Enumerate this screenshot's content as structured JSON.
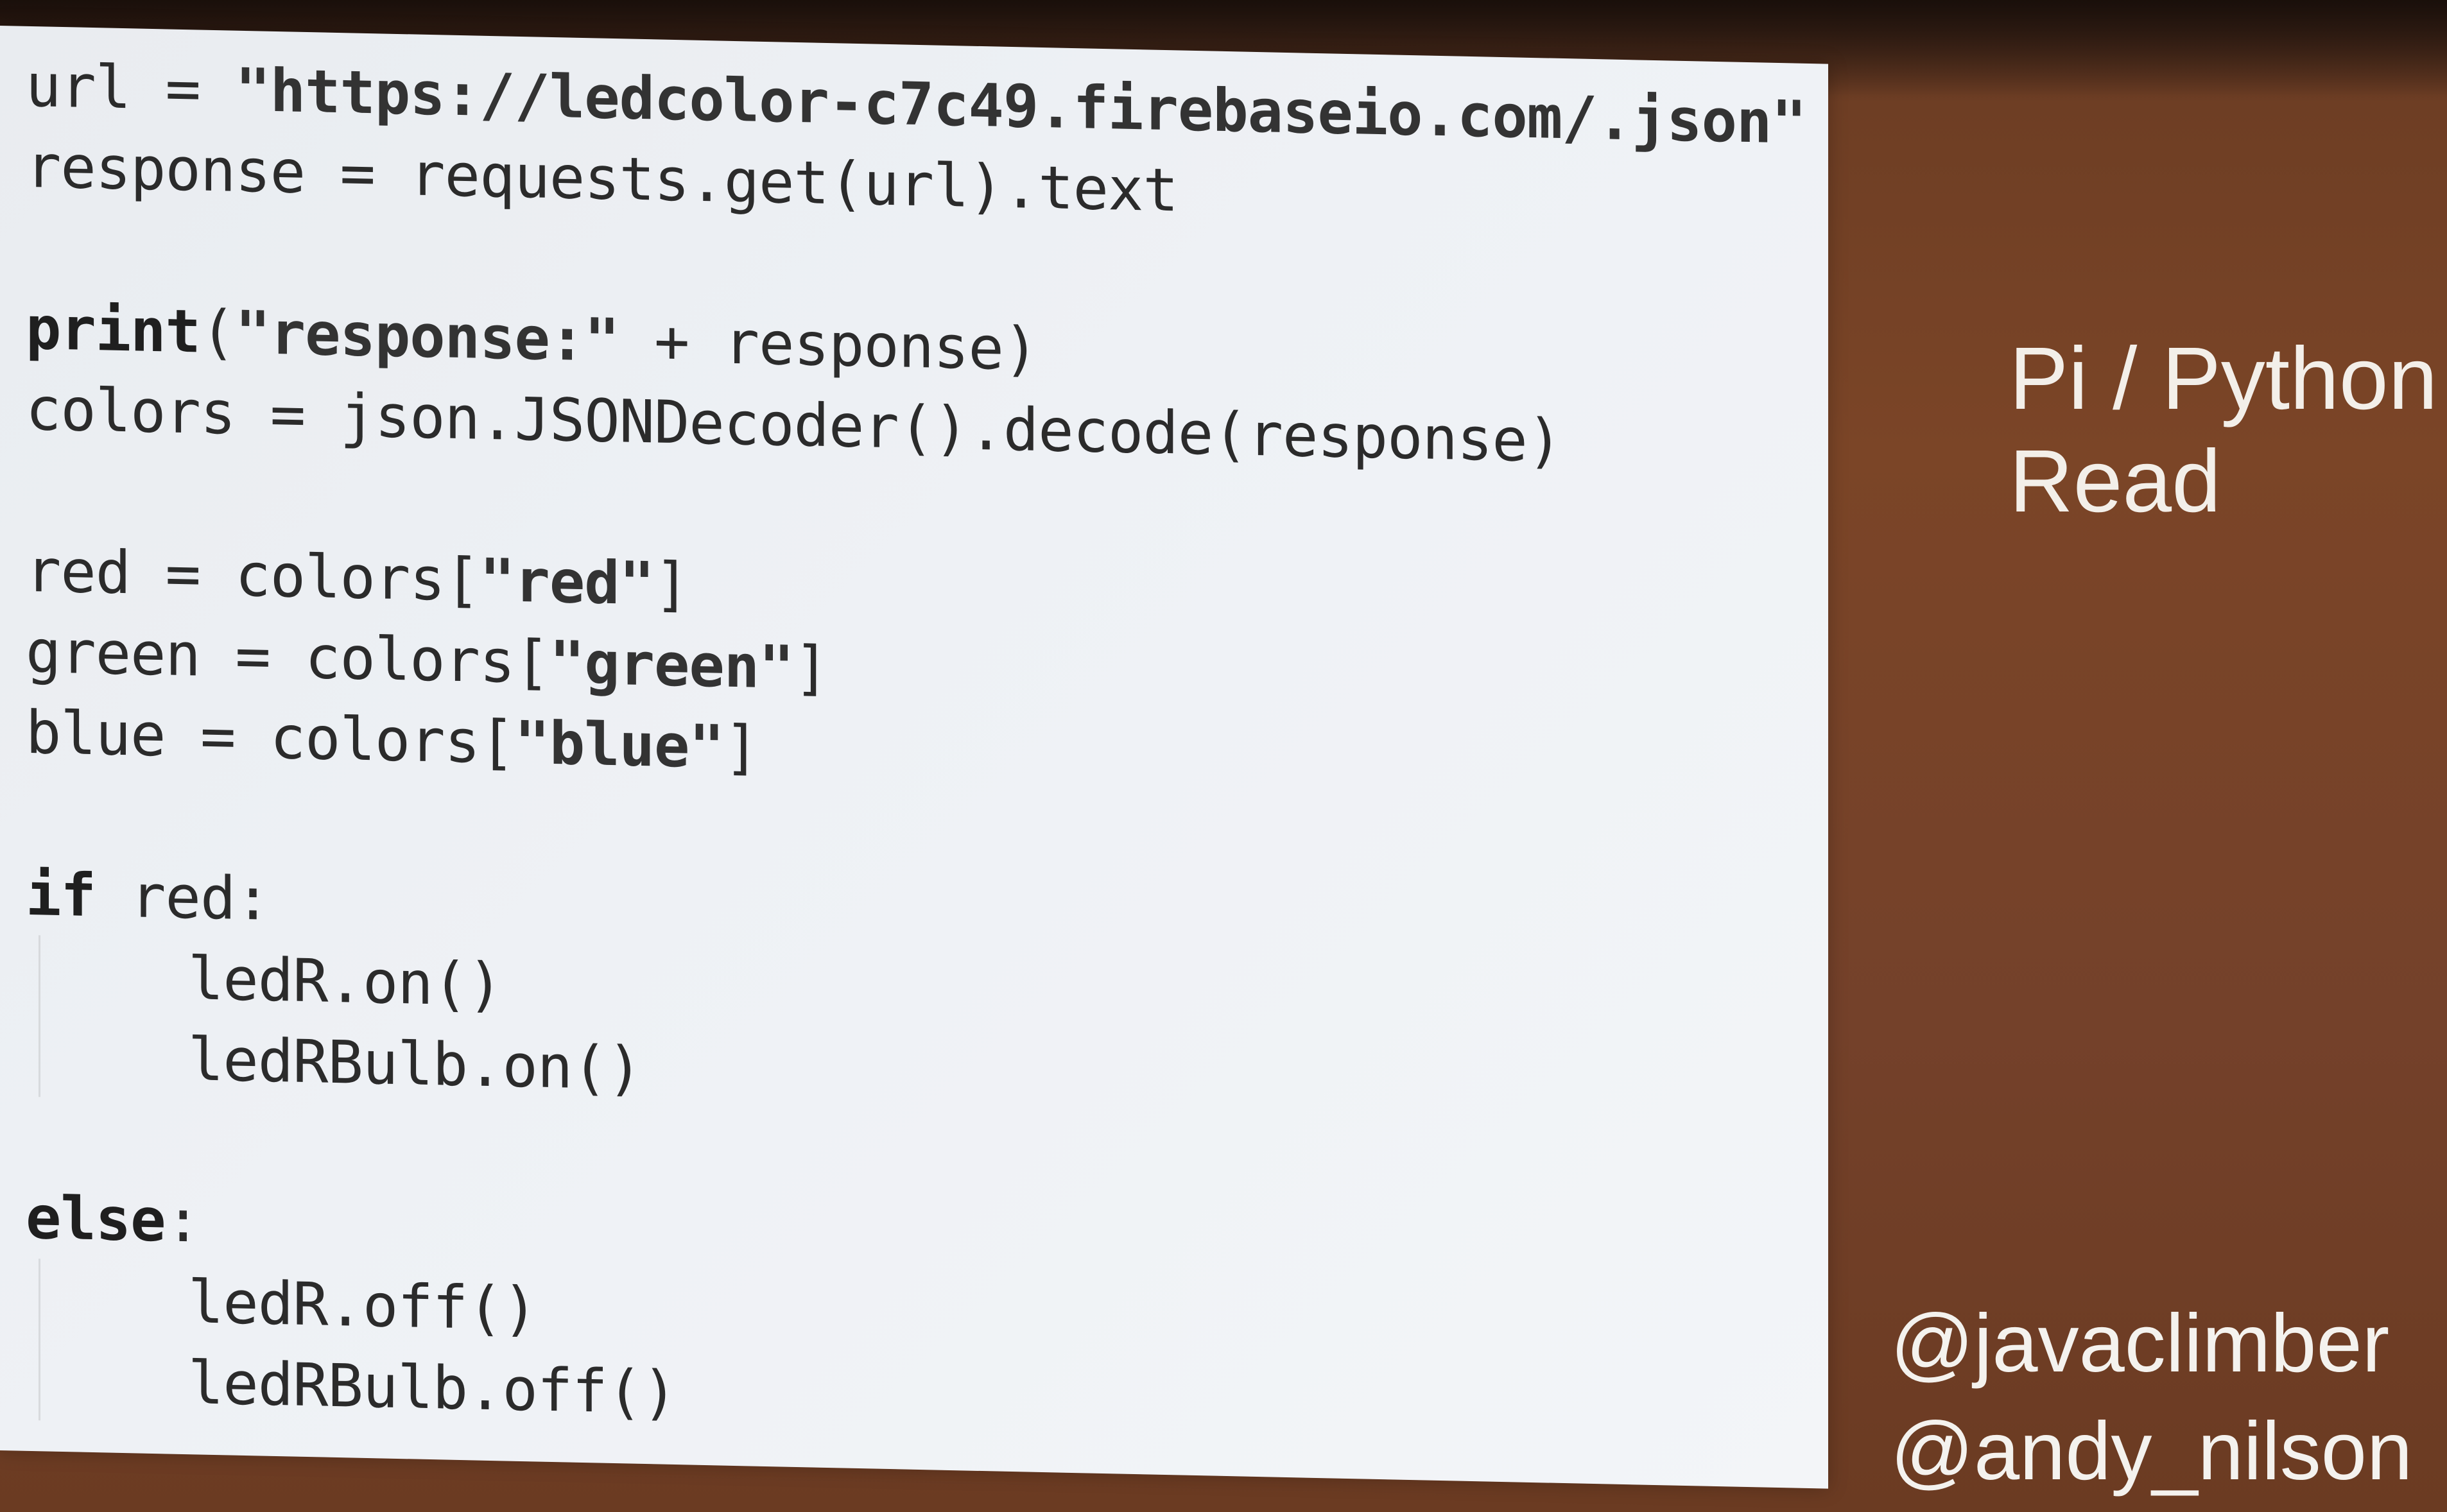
{
  "slide": {
    "title_line1": "Pi / Python",
    "title_line2": "Read",
    "handle1": "@javaclimber",
    "handle2": "@andy_nilson"
  },
  "code": {
    "l1_pre": "url = ",
    "l1_str": "\"https://ledcolor-c7c49.firebaseio.com/.json\"",
    "l2": "response = requests.get(url).text",
    "l3_kw": "print",
    "l3_mid": "(",
    "l3_str": "\"response:\"",
    "l3_post": " + response)",
    "l4": "colors = json.JSONDecoder().decode(response)",
    "l5_pre": "red = colors[",
    "l5_str": "\"red\"",
    "l5_post": "]",
    "l6_pre": "green = colors[",
    "l6_str": "\"green\"",
    "l6_post": "]",
    "l7_pre": "blue = colors[",
    "l7_str": "\"blue\"",
    "l7_post": "]",
    "l8_kw": "if",
    "l8_post": " red:",
    "l9": "ledR.on()",
    "l10": "ledRBulb.on()",
    "l11_kw": "else",
    "l11_post": ":",
    "l12": "ledR.off()",
    "l13": "ledRBulb.off()"
  }
}
